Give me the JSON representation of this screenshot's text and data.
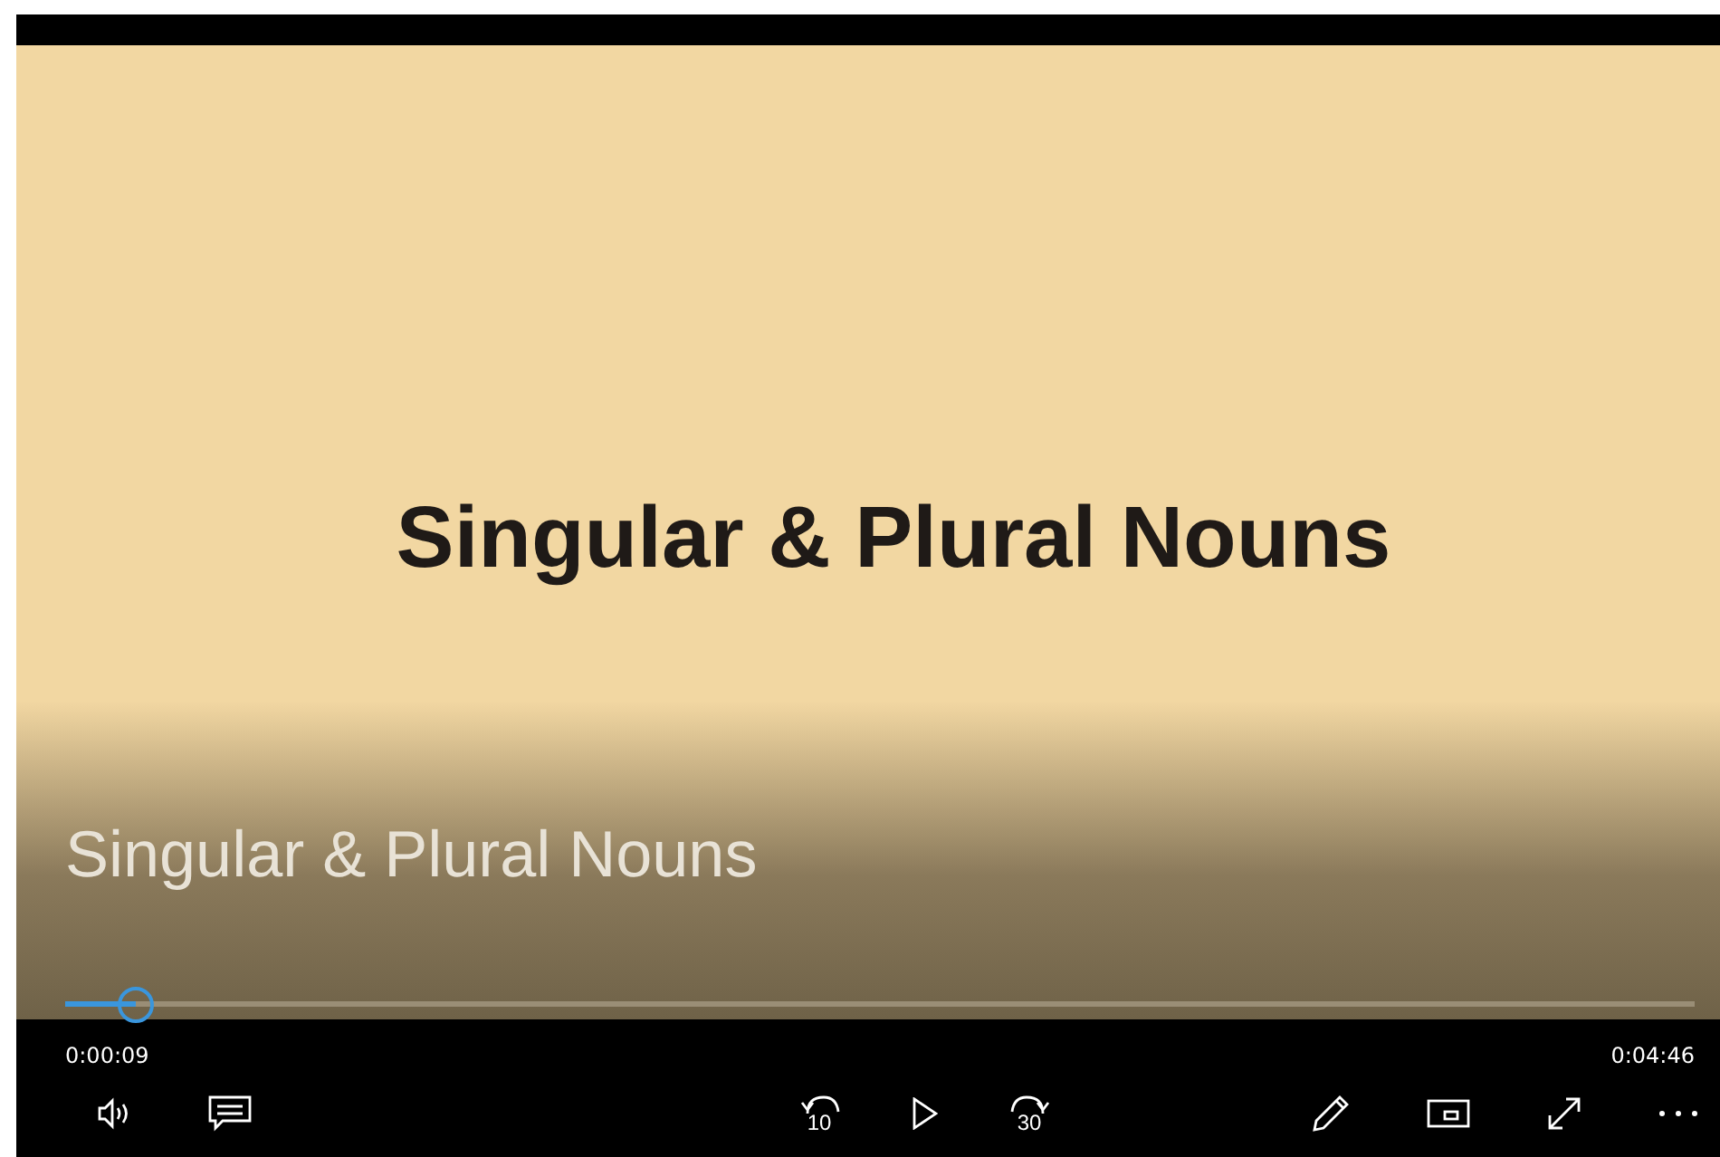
{
  "video": {
    "slide_title": "Singular & Plural Nouns",
    "overlay_title": "Singular & Plural Nouns"
  },
  "progress": {
    "level": 0.043,
    "elapsed": "0:00:09",
    "duration": "0:04:46"
  },
  "controls": {
    "skip_back": "10",
    "skip_forward": "30"
  }
}
